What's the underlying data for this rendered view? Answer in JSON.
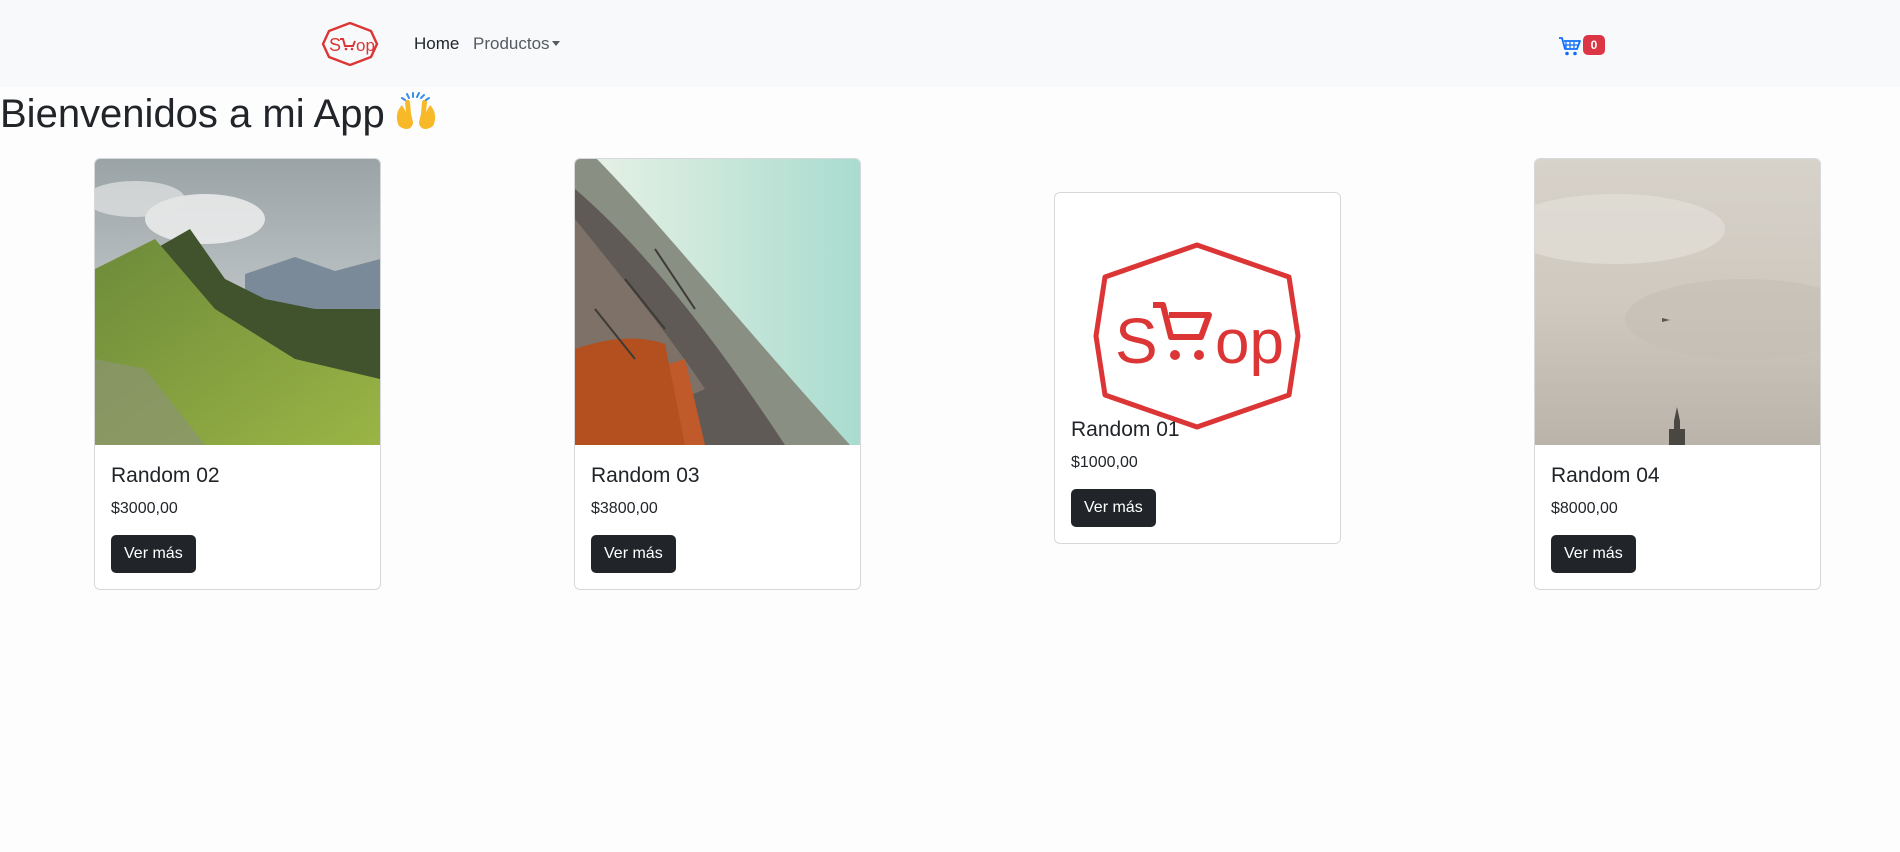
{
  "navbar": {
    "brand_logo_text": "Shop",
    "home_label": "Home",
    "productos_label": "Productos",
    "cart_count": "0"
  },
  "main": {
    "title": "Bienvenidos a mi App"
  },
  "products": [
    {
      "name": "Random 02",
      "price": "$3000,00",
      "button_label": "Ver más"
    },
    {
      "name": "Random 03",
      "price": "$3800,00",
      "button_label": "Ver más"
    },
    {
      "name": "Random 01",
      "price": "$1000,00",
      "button_label": "Ver más"
    },
    {
      "name": "Random 04",
      "price": "$8000,00",
      "button_label": "Ver más"
    }
  ],
  "colors": {
    "navbar_bg": "#f8f9fa",
    "brand_red": "#dc3535",
    "button_dark": "#212529",
    "badge_red": "#dc3545",
    "cart_blue": "#0d6efd"
  }
}
